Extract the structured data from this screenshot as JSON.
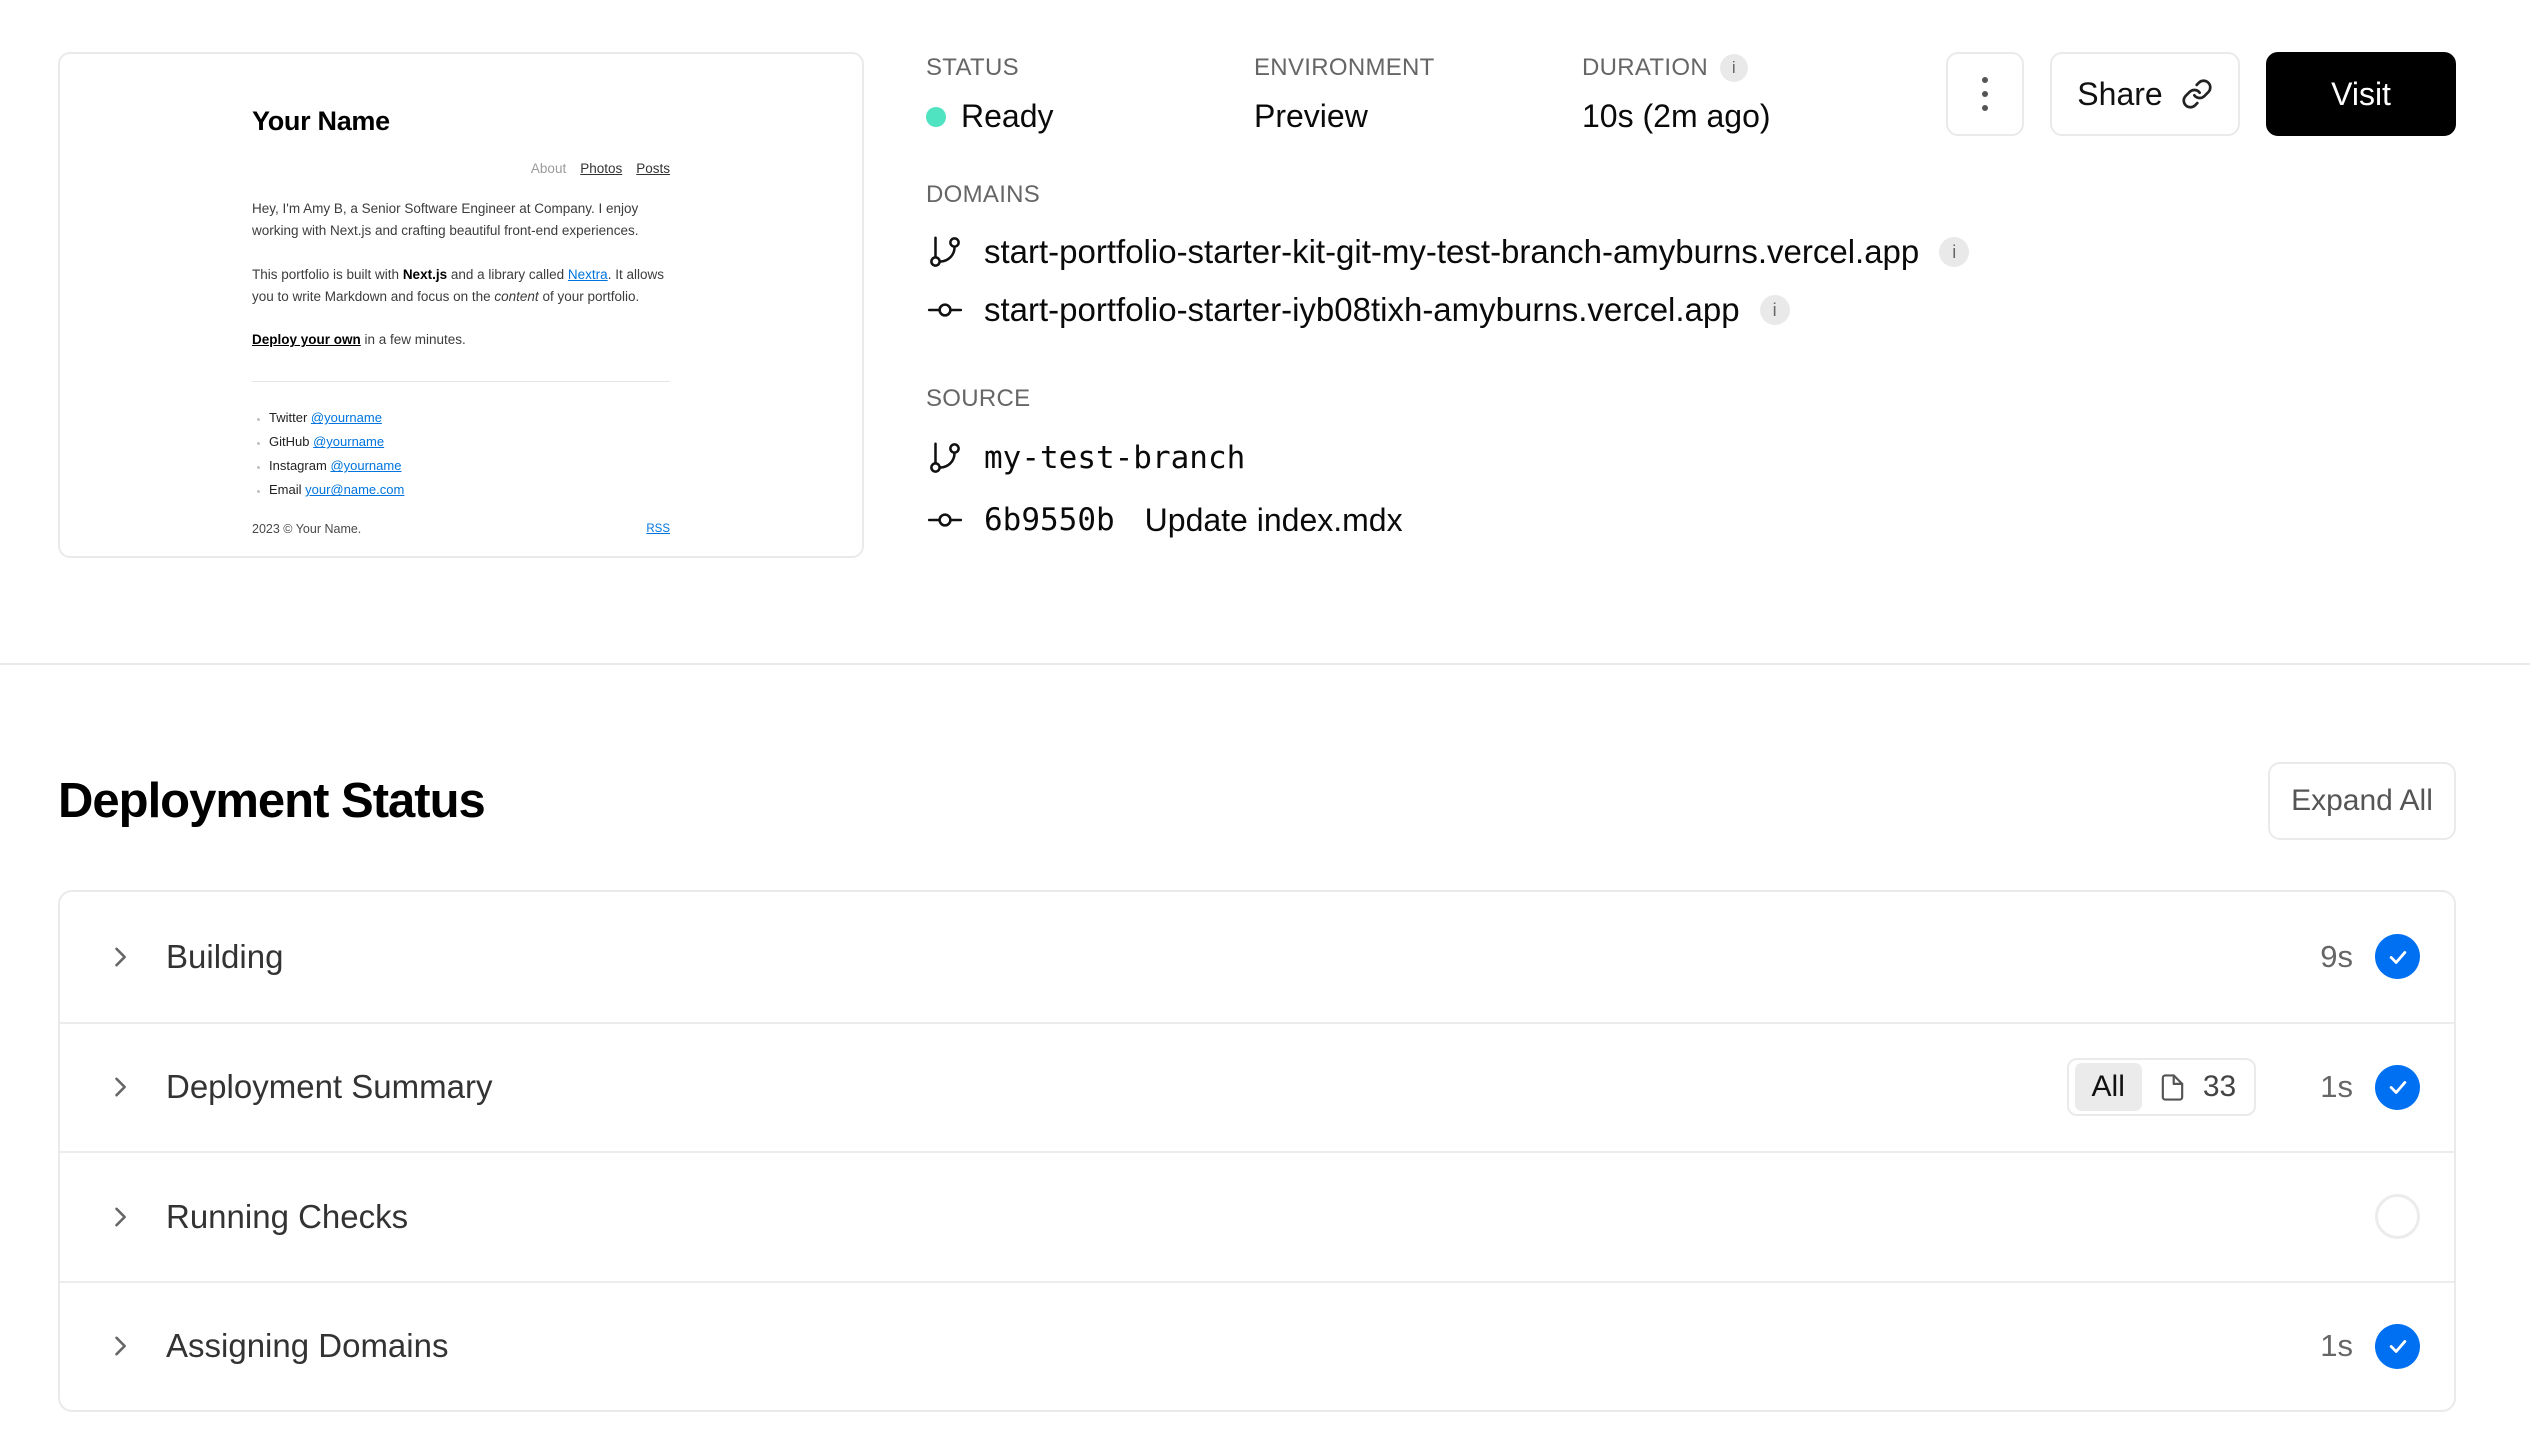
{
  "colors": {
    "accent_blue": "#0070f3",
    "ready_green": "#50e3c2",
    "border_gray": "#eaeaea"
  },
  "preview": {
    "title": "Your Name",
    "nav": [
      "About",
      "Photos",
      "Posts"
    ],
    "p1": "Hey, I'm Amy B, a Senior Software Engineer at Company. I enjoy working with Next.js and crafting beautiful front-end experiences.",
    "p2_pre": "This portfolio is built with ",
    "p2_bold": "Next.js",
    "p2_mid": " and a library called ",
    "p2_link": "Nextra",
    "p2_after": ". It allows you to write Markdown and focus on the ",
    "p2_italic": "content",
    "p2_end": " of your portfolio.",
    "p3_bold": "Deploy your own",
    "p3_rest": " in a few minutes.",
    "links": [
      {
        "label": "Twitter",
        "handle": "@yourname"
      },
      {
        "label": "GitHub",
        "handle": "@yourname"
      },
      {
        "label": "Instagram",
        "handle": "@yourname"
      },
      {
        "label": "Email",
        "handle": "your@name.com"
      }
    ],
    "footer_copyright": "2023 © Your Name.",
    "footer_rss": "RSS"
  },
  "meta": {
    "status_label": "STATUS",
    "status_value": "Ready",
    "environment_label": "ENVIRONMENT",
    "environment_value": "Preview",
    "duration_label": "DURATION",
    "duration_value": "10s (2m ago)",
    "duration_info_icon": "info-icon",
    "info_glyph": "i"
  },
  "domains": {
    "label": "DOMAINS",
    "items": [
      {
        "icon": "git-branch-icon",
        "url": "start-portfolio-starter-kit-git-my-test-branch-amyburns.vercel.app"
      },
      {
        "icon": "git-commit-icon",
        "url": "start-portfolio-starter-iyb08tixh-amyburns.vercel.app"
      }
    ]
  },
  "source": {
    "label": "SOURCE",
    "branch_icon": "git-branch-icon",
    "branch": "my-test-branch",
    "commit_icon": "git-commit-icon",
    "commit_sha": "6b9550b",
    "commit_message": "Update index.mdx"
  },
  "actions": {
    "menu_icon": "kebab-menu-icon",
    "share_label": "Share",
    "share_icon": "link-icon",
    "visit_label": "Visit"
  },
  "deployment_status": {
    "title": "Deployment Status",
    "expand_all_label": "Expand All",
    "rows": [
      {
        "title": "Building",
        "duration": "9s",
        "state": "done"
      },
      {
        "title": "Deployment Summary",
        "duration": "1s",
        "state": "done",
        "badge": {
          "all": "All",
          "file_icon": "file-icon",
          "count": "33"
        }
      },
      {
        "title": "Running Checks",
        "duration": "",
        "state": "pending"
      },
      {
        "title": "Assigning Domains",
        "duration": "1s",
        "state": "done"
      }
    ]
  }
}
